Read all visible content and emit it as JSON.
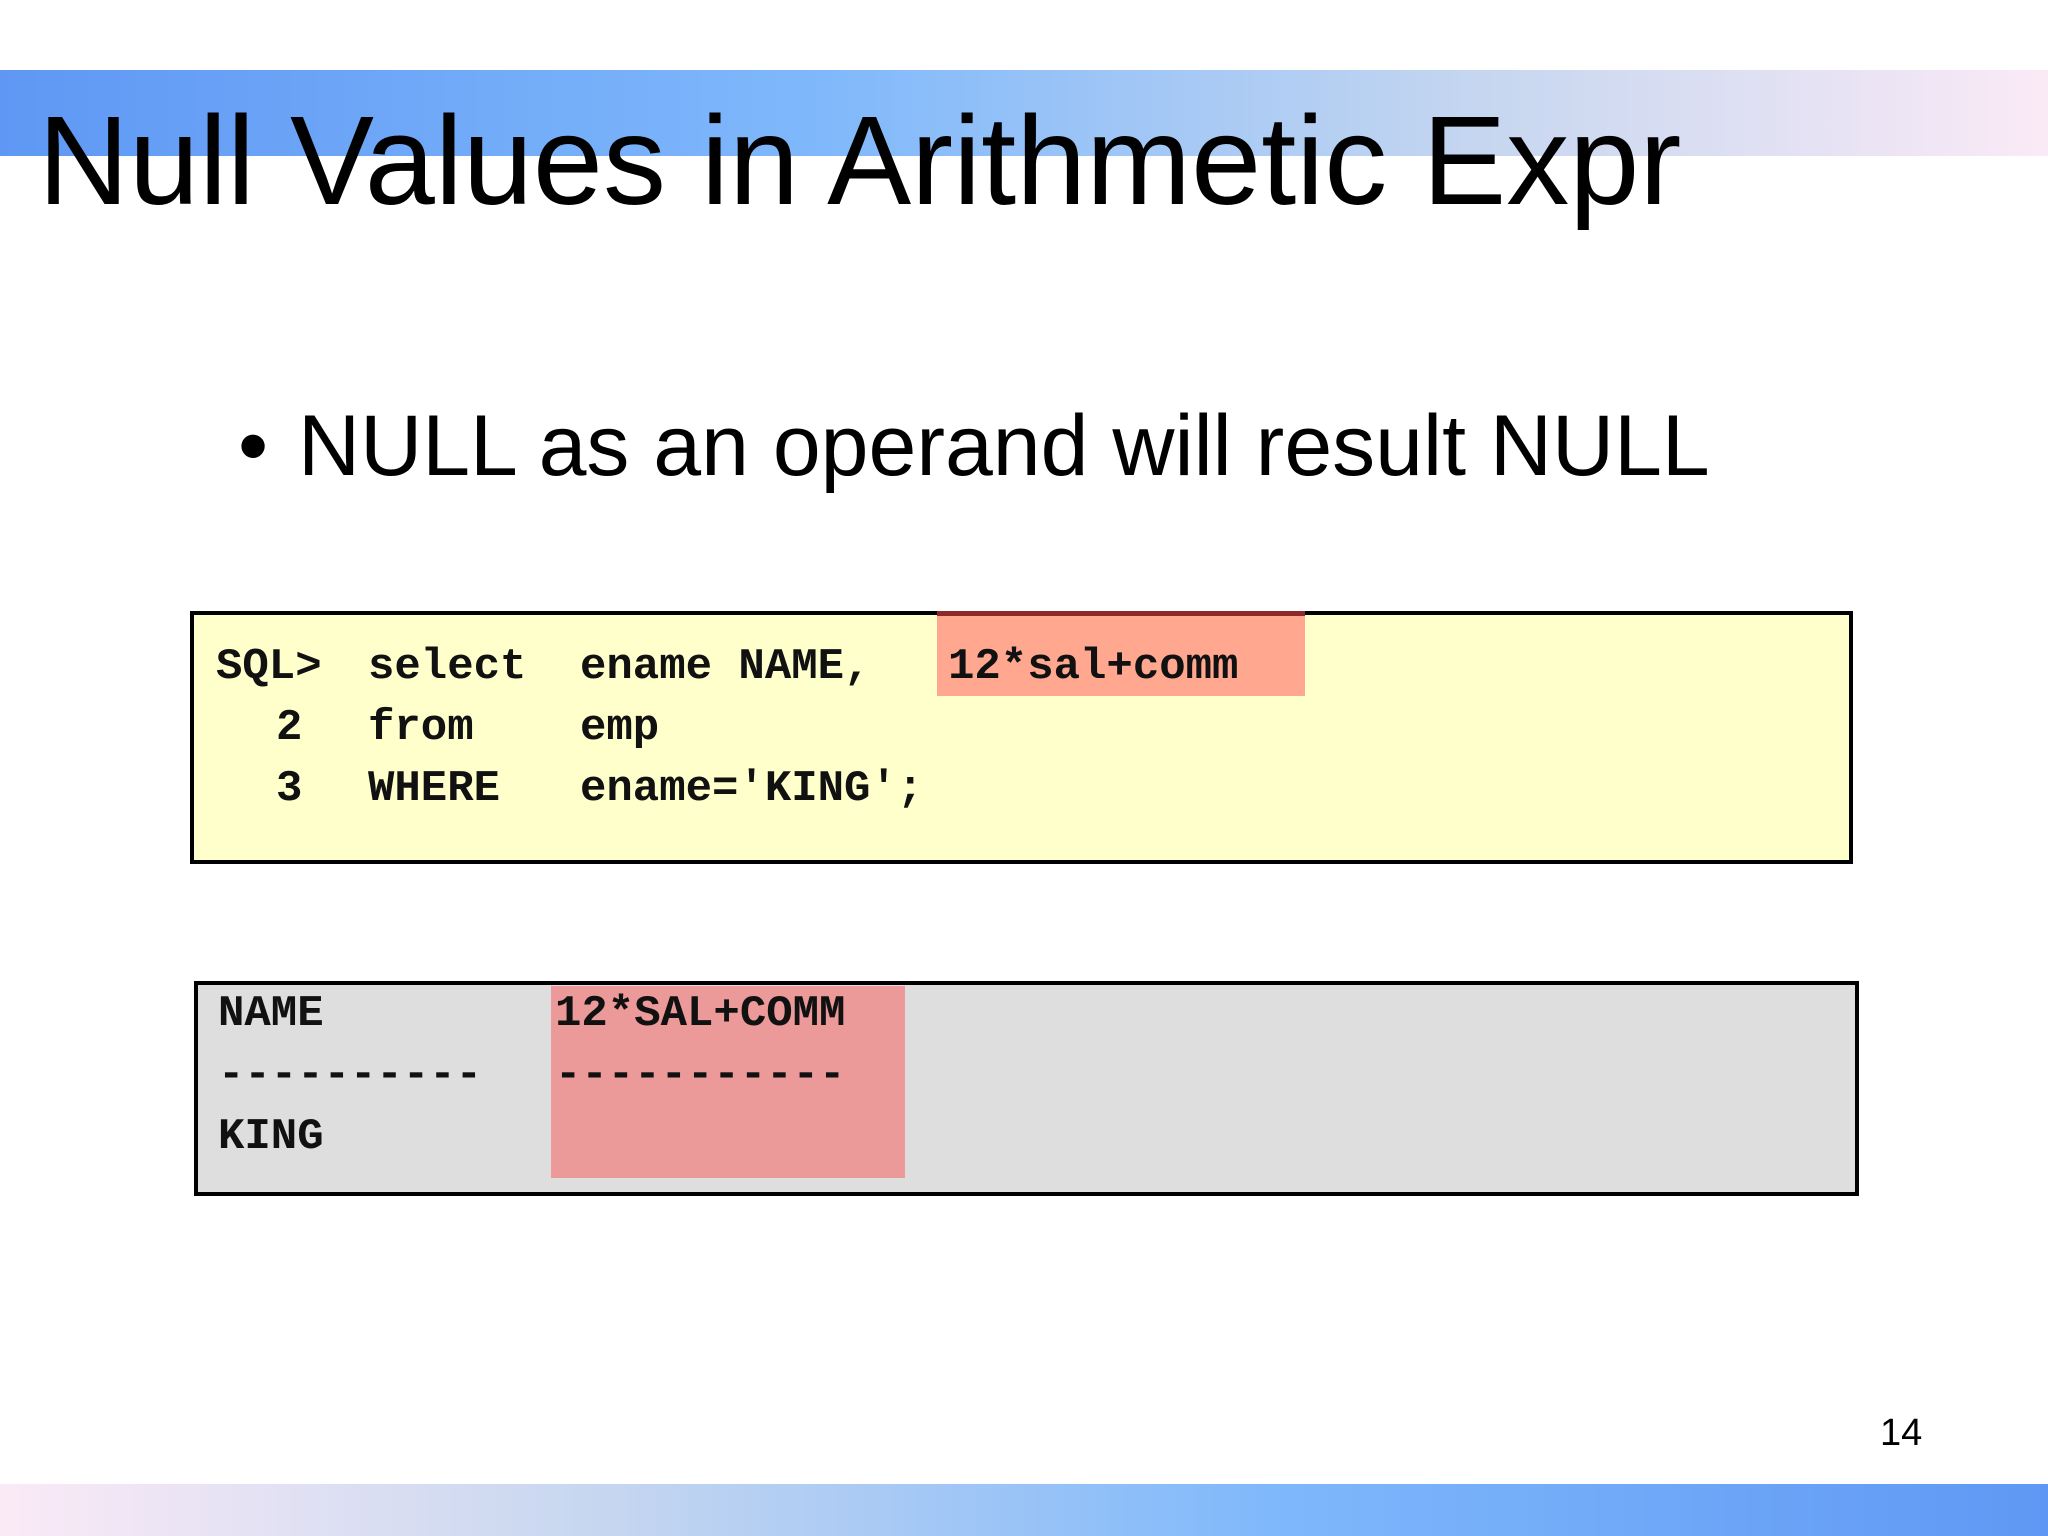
{
  "slide": {
    "title": "Null Values in Arithmetic Expr",
    "bullet_symbol": "•",
    "bullet": "NULL as an operand will result NULL",
    "page_number": "14"
  },
  "query": {
    "prompt": "SQL>",
    "select_keyword": "select",
    "select_column": "ename NAME,",
    "select_expression": "12*sal+comm",
    "line_2_number": "2",
    "from_keyword": "from",
    "from_table": "emp",
    "line_3_number": "3",
    "where_keyword": "WHERE",
    "where_condition": "ename='KING';"
  },
  "result": {
    "header_name": "NAME",
    "header_expression": "12*SAL+COMM",
    "separator_name": "----------",
    "separator_expression": "-----------",
    "row_name": "KING",
    "row_expression": ""
  },
  "colors": {
    "code_background": "#ffffcc",
    "output_background": "#dedede",
    "query_highlight": "#ffa78f",
    "result_highlight": "#ec9999",
    "band_blue": "#5f98f4",
    "band_pink": "#fbeaf6"
  }
}
